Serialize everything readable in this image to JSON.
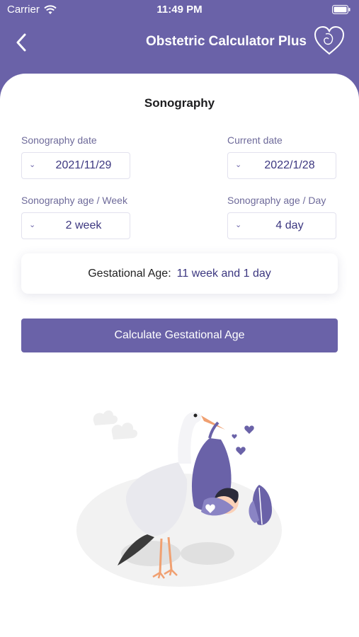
{
  "status_bar": {
    "carrier": "Carrier",
    "time": "11:49 PM"
  },
  "nav": {
    "title": "Obstetric Calculator Plus"
  },
  "section": {
    "title": "Sonography"
  },
  "fields": {
    "sonography_date": {
      "label": "Sonography date",
      "value": "2021/11/29"
    },
    "current_date": {
      "label": "Current date",
      "value": "2022/1/28"
    },
    "age_week": {
      "label": "Sonography age / Week",
      "value": "2 week"
    },
    "age_day": {
      "label": "Sonography age / Day",
      "value": "4 day"
    }
  },
  "result": {
    "label": "Gestational Age:",
    "value": "11 week and 1 day"
  },
  "button": {
    "label": "Calculate Gestational Age"
  },
  "colors": {
    "brand": "#6a62a8",
    "accent_text": "#3c3780",
    "label_text": "#6e6a9a"
  },
  "icons": [
    "wifi-icon",
    "battery-icon",
    "back-arrow-icon",
    "heart-logo-icon",
    "chevron-down-icon",
    "stork-baby-illustration"
  ]
}
